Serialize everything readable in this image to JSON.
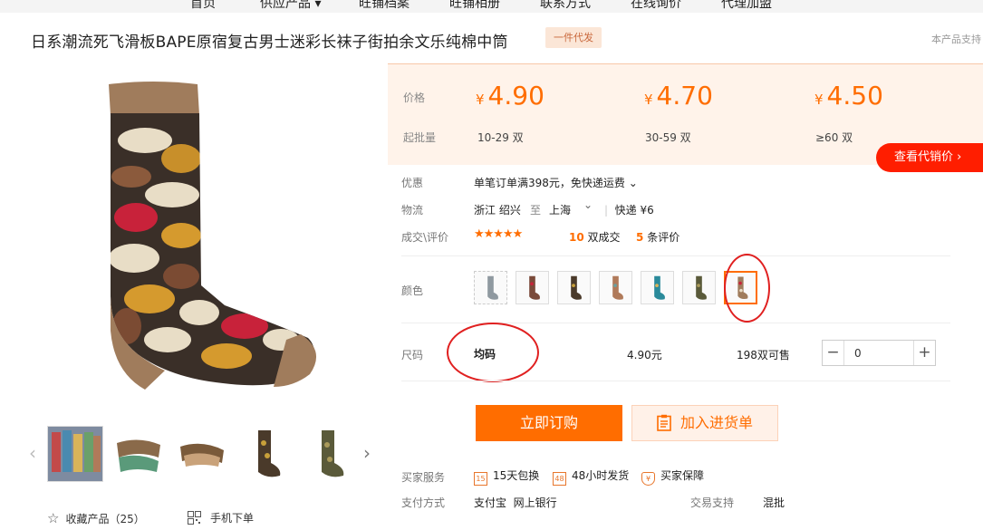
{
  "topnav": [
    "首页",
    "供应产品 ▾",
    "旺铺档案",
    "旺铺相册",
    "联系方式",
    "在线询价",
    "代理加盟"
  ],
  "title": "日系潮流死飞滑板BAPE原宿复古男士迷彩长袜子街拍余文乐纯棉中筒",
  "dropship_badge": "一件代发",
  "right_note": "本产品支持",
  "pricing": {
    "price_label": "价格",
    "moq_label": "起批量",
    "currency": "¥",
    "tiers": [
      {
        "price": "4.90",
        "range": "10-29 双"
      },
      {
        "price": "4.70",
        "range": "30-59 双"
      },
      {
        "price": "4.50",
        "range": "≥60 双"
      }
    ],
    "agent_button": "查看代销价 ›"
  },
  "promo": {
    "label": "优惠",
    "value": "单笔订单满398元，免快递运费 ⌄"
  },
  "logistics": {
    "label": "物流",
    "from": "浙江 绍兴",
    "to_word": "至",
    "to": "上海",
    "chev": "⌄",
    "method": "快递 ¥6"
  },
  "deals": {
    "label": "成交\\评价",
    "stars": "★★★★★",
    "sold_count": "10",
    "sold_unit": "双成交",
    "review_count": "5",
    "review_unit": "条评价"
  },
  "color": {
    "label": "颜色"
  },
  "size": {
    "label": "尺码",
    "name": "均码",
    "price": "4.90元",
    "stock": "198双可售"
  },
  "quantity": {
    "minus": "−",
    "value": "0",
    "plus": "+"
  },
  "actions": {
    "buy_now": "立即订购",
    "add_cart": "加入进货单"
  },
  "services": {
    "label": "买家服务",
    "items": [
      {
        "icon": "15",
        "text": "15天包换"
      },
      {
        "icon": "48",
        "text": "48小时发货"
      },
      {
        "icon": "¥",
        "text": "买家保障"
      }
    ]
  },
  "payment": {
    "label": "支付方式",
    "methods": "支付宝  网上银行",
    "trade_label": "交易支持",
    "trade_value": "混批"
  },
  "footer": {
    "favorite": "收藏产品（25）",
    "favorite_icon": "☆",
    "mobile_order": "手机下单"
  },
  "colors": {
    "accent": "#ff6d00",
    "price_bg": "#fff3ea",
    "agent_red": "#ff1e00",
    "annotation": "#e02020"
  }
}
